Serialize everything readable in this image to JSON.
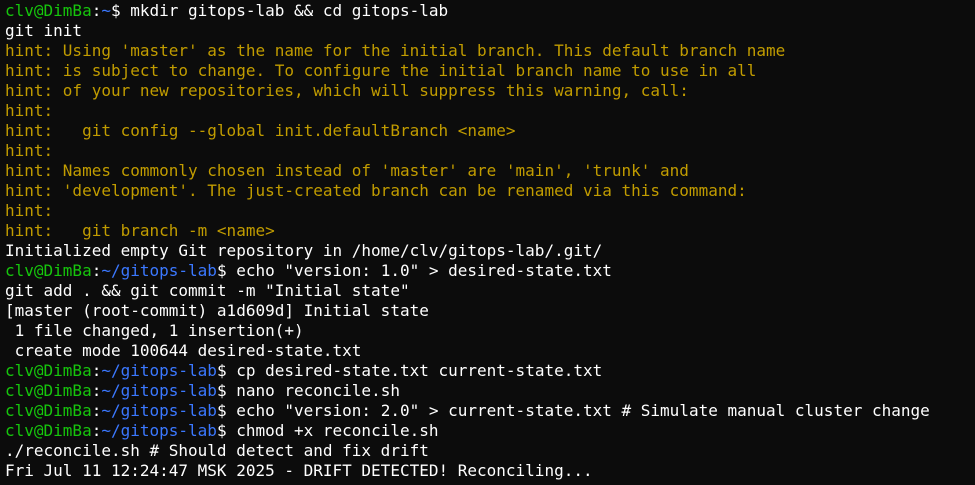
{
  "window": {
    "background": "#0c0c0c"
  },
  "colors": {
    "prompt_user": "#16c60c",
    "prompt_path": "#3b78ff",
    "hint": "#c19c00",
    "text": "#ffffff"
  },
  "lines": [
    {
      "type": "prompt",
      "user": "clv@DimBa",
      "sep": ":",
      "path": "~",
      "dollar": "$ ",
      "command": "mkdir gitops-lab && cd gitops-lab"
    },
    {
      "type": "output",
      "text": "git init"
    },
    {
      "type": "hint",
      "text": "hint: Using 'master' as the name for the initial branch. This default branch name"
    },
    {
      "type": "hint",
      "text": "hint: is subject to change. To configure the initial branch name to use in all"
    },
    {
      "type": "hint",
      "text": "hint: of your new repositories, which will suppress this warning, call:"
    },
    {
      "type": "hint",
      "text": "hint:"
    },
    {
      "type": "hint",
      "text": "hint:   git config --global init.defaultBranch <name>"
    },
    {
      "type": "hint",
      "text": "hint:"
    },
    {
      "type": "hint",
      "text": "hint: Names commonly chosen instead of 'master' are 'main', 'trunk' and"
    },
    {
      "type": "hint",
      "text": "hint: 'development'. The just-created branch can be renamed via this command:"
    },
    {
      "type": "hint",
      "text": "hint:"
    },
    {
      "type": "hint",
      "text": "hint:   git branch -m <name>"
    },
    {
      "type": "output",
      "text": "Initialized empty Git repository in /home/clv/gitops-lab/.git/"
    },
    {
      "type": "prompt",
      "user": "clv@DimBa",
      "sep": ":",
      "path": "~/gitops-lab",
      "dollar": "$ ",
      "command": "echo \"version: 1.0\" > desired-state.txt"
    },
    {
      "type": "output",
      "text": "git add . && git commit -m \"Initial state\""
    },
    {
      "type": "output",
      "text": "[master (root-commit) a1d609d] Initial state"
    },
    {
      "type": "output",
      "text": " 1 file changed, 1 insertion(+)"
    },
    {
      "type": "output",
      "text": " create mode 100644 desired-state.txt"
    },
    {
      "type": "prompt",
      "user": "clv@DimBa",
      "sep": ":",
      "path": "~/gitops-lab",
      "dollar": "$ ",
      "command": "cp desired-state.txt current-state.txt"
    },
    {
      "type": "prompt",
      "user": "clv@DimBa",
      "sep": ":",
      "path": "~/gitops-lab",
      "dollar": "$ ",
      "command": "nano reconcile.sh"
    },
    {
      "type": "prompt",
      "user": "clv@DimBa",
      "sep": ":",
      "path": "~/gitops-lab",
      "dollar": "$ ",
      "command": "echo \"version: 2.0\" > current-state.txt # Simulate manual cluster change"
    },
    {
      "type": "prompt",
      "user": "clv@DimBa",
      "sep": ":",
      "path": "~/gitops-lab",
      "dollar": "$ ",
      "command": "chmod +x reconcile.sh"
    },
    {
      "type": "output",
      "text": "./reconcile.sh # Should detect and fix drift"
    },
    {
      "type": "output",
      "text": "Fri Jul 11 12:24:47 MSK 2025 - DRIFT DETECTED! Reconciling..."
    }
  ]
}
